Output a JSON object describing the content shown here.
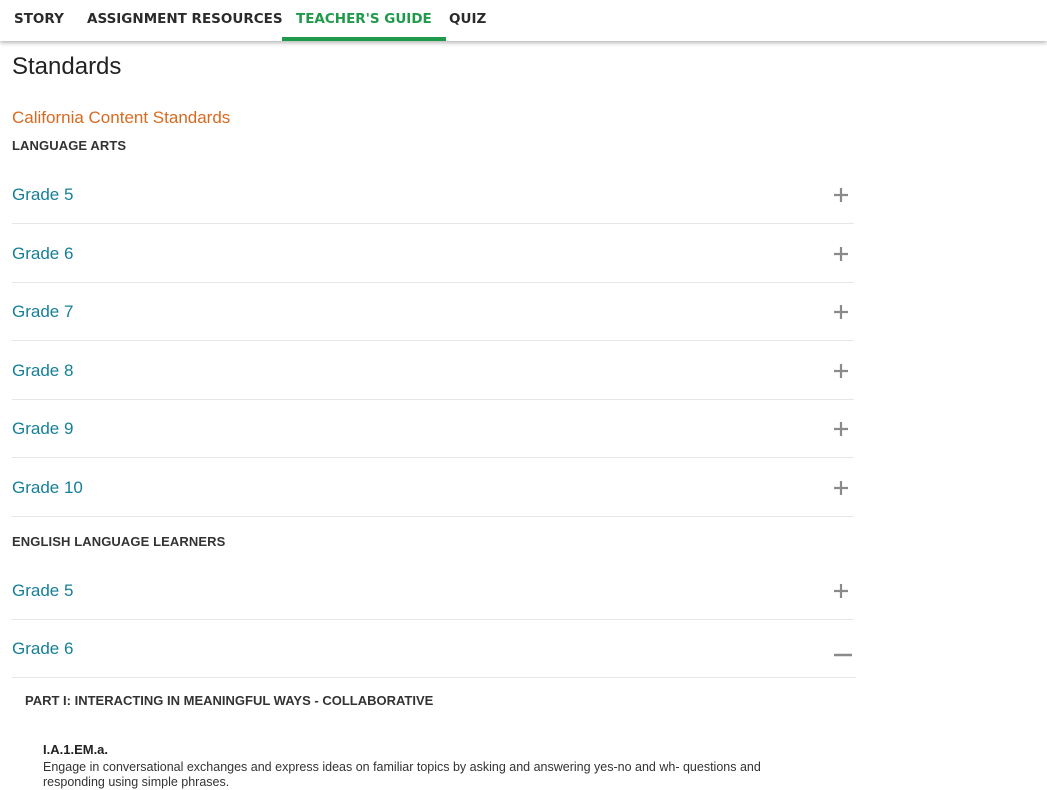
{
  "tabs": [
    {
      "label": "STORY",
      "active": false
    },
    {
      "label": "ASSIGNMENT RESOURCES",
      "active": false
    },
    {
      "label": "TEACHER'S GUIDE",
      "active": true
    },
    {
      "label": "QUIZ",
      "active": false
    }
  ],
  "page": {
    "title": "Standards",
    "standards_link": "California Content Standards"
  },
  "sections": [
    {
      "heading": "LANGUAGE ARTS",
      "grades": [
        {
          "label": "Grade 5",
          "icon": "plus-icon"
        },
        {
          "label": "Grade 6",
          "icon": "plus-icon"
        },
        {
          "label": "Grade 7",
          "icon": "plus-icon"
        },
        {
          "label": "Grade 8",
          "icon": "plus-icon"
        },
        {
          "label": "Grade 9",
          "icon": "plus-icon"
        },
        {
          "label": "Grade 10",
          "icon": "plus-icon"
        }
      ]
    },
    {
      "heading": "ENGLISH LANGUAGE LEARNERS",
      "grades": [
        {
          "label": "Grade 5",
          "icon": "plus-icon"
        },
        {
          "label": "Grade 6",
          "icon": "minus-icon",
          "expanded": true
        }
      ]
    }
  ],
  "expanded": {
    "part_heading": "PART I: INTERACTING IN MEANINGFUL WAYS - COLLABORATIVE",
    "standard_code": "I.A.1.EM.a.",
    "standard_text": "Engage in conversational exchanges and express ideas on familiar topics by asking and answering yes-no and wh- questions and responding using simple phrases."
  },
  "colors": {
    "active_tab": "#1f9a4a",
    "link_orange": "#d86a1f",
    "grade_teal": "#157f96",
    "icon_gray": "#8a8a8a"
  }
}
